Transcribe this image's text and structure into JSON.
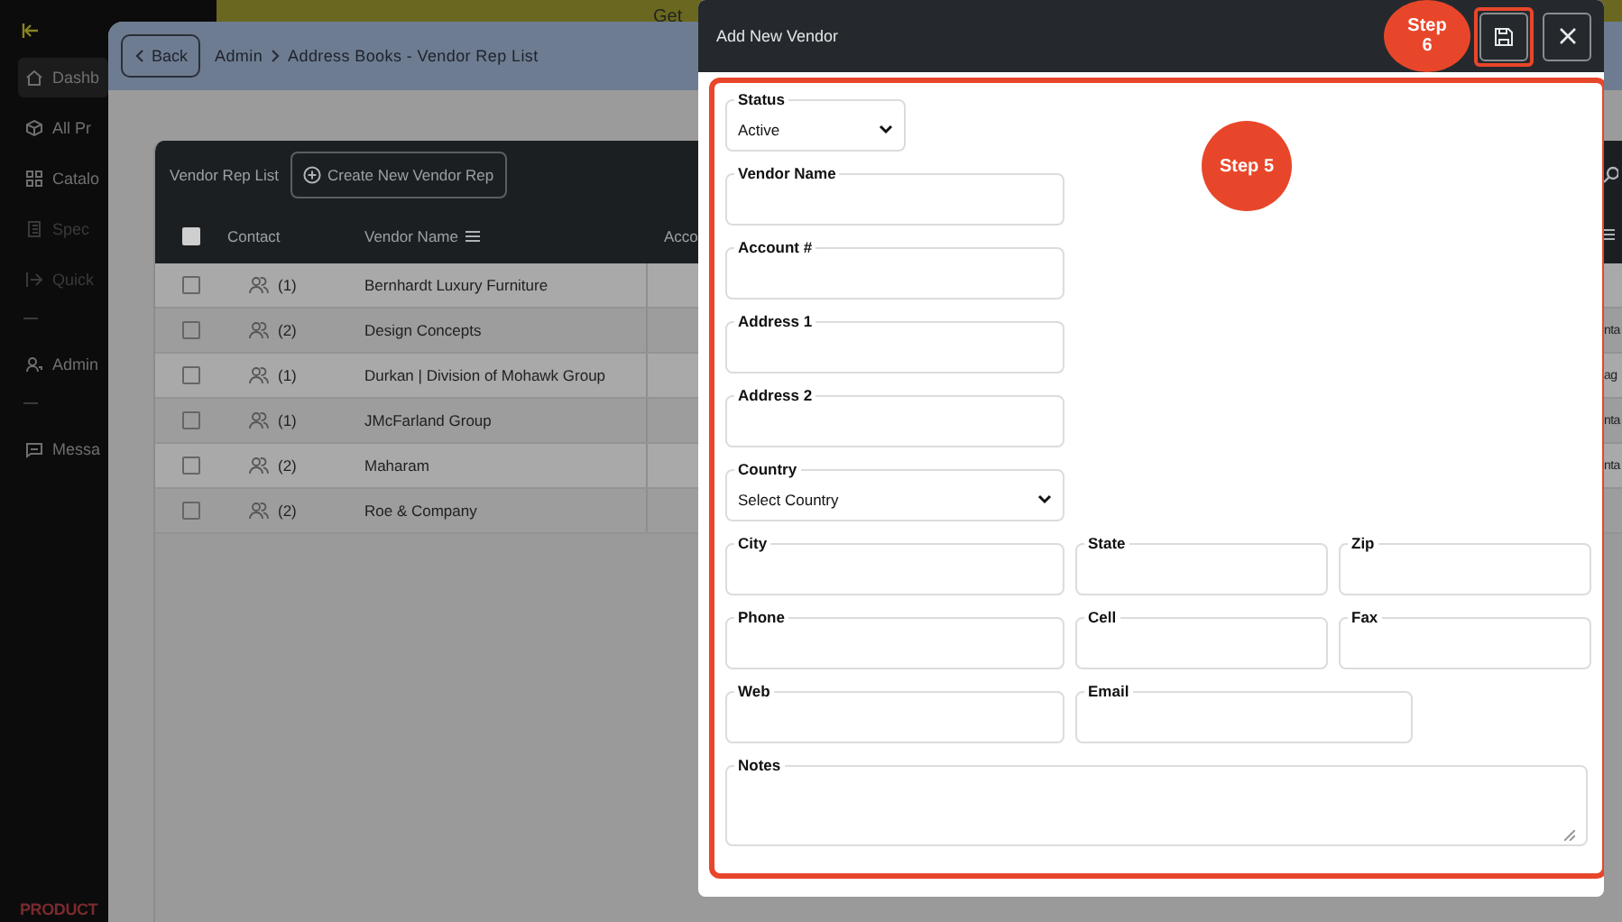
{
  "banner": {
    "text": "Get"
  },
  "sidebar": {
    "items": [
      {
        "kind": "link",
        "label": "Dashb",
        "selected": true
      },
      {
        "kind": "link",
        "label": "All Pr",
        "selected": false
      },
      {
        "kind": "link",
        "label": "Catalo",
        "selected": false
      },
      {
        "kind": "link",
        "label": "Spec",
        "selected": false,
        "disabled": true
      },
      {
        "kind": "link",
        "label": "Quick",
        "selected": false,
        "disabled": true
      },
      {
        "kind": "divider"
      },
      {
        "kind": "link",
        "label": "Admin",
        "selected": false
      },
      {
        "kind": "divider"
      },
      {
        "kind": "link",
        "label": "Messa",
        "selected": false
      }
    ],
    "logo": "PRODUCT"
  },
  "page": {
    "back": "Back",
    "breadcrumb": [
      "Admin",
      "Address Books - Vendor Rep List"
    ]
  },
  "table": {
    "title": "Vendor Rep List",
    "select_all_checked": false,
    "create_button": "Create New Vendor Rep",
    "columns": [
      "Contact",
      "Vendor Name",
      "Acco"
    ],
    "rows": [
      {
        "checked": false,
        "contacts": "(1)",
        "vendor_name": "Bernhardt Luxury Furniture"
      },
      {
        "checked": false,
        "contacts": "(2)",
        "vendor_name": "Design Concepts",
        "column_5": "nta"
      },
      {
        "checked": false,
        "contacts": "(1)",
        "vendor_name": "Durkan | Division of Mohawk Group",
        "column_5": "ag"
      },
      {
        "checked": false,
        "contacts": "(1)",
        "vendor_name": "JMcFarland Group",
        "column_5": "nta"
      },
      {
        "checked": false,
        "contacts": "(2)",
        "vendor_name": "Maharam",
        "column_5": "nta"
      },
      {
        "checked": false,
        "contacts": "(2)",
        "vendor_name": "Roe & Company"
      }
    ]
  },
  "drawer": {
    "title": "Add New Vendor",
    "rows": [
      [
        {
          "label": "Status",
          "kind": "select",
          "value": "Active"
        }
      ],
      [
        {
          "label": "Vendor Name",
          "kind": "text"
        }
      ],
      [
        {
          "label": "Account #",
          "kind": "text"
        }
      ],
      [
        {
          "label": "Address 1",
          "kind": "text"
        }
      ],
      [
        {
          "label": "Address 2",
          "kind": "text"
        }
      ],
      [
        {
          "label": "Country",
          "kind": "select",
          "value": "Select Country"
        }
      ],
      [
        {
          "label": "City",
          "kind": "text"
        },
        {
          "label": "State",
          "kind": "text"
        },
        {
          "label": "Zip",
          "kind": "text"
        }
      ],
      [
        {
          "label": "Phone",
          "kind": "text"
        },
        {
          "label": "Cell",
          "kind": "text"
        },
        {
          "label": "Fax",
          "kind": "text"
        }
      ],
      [
        {
          "label": "Web",
          "kind": "text"
        },
        {
          "label": "Email",
          "kind": "text"
        }
      ],
      [
        {
          "label": "Notes",
          "kind": "textarea"
        }
      ]
    ]
  },
  "annotations": [
    {
      "text": "Step 6"
    },
    {
      "text": "Step 5"
    }
  ]
}
